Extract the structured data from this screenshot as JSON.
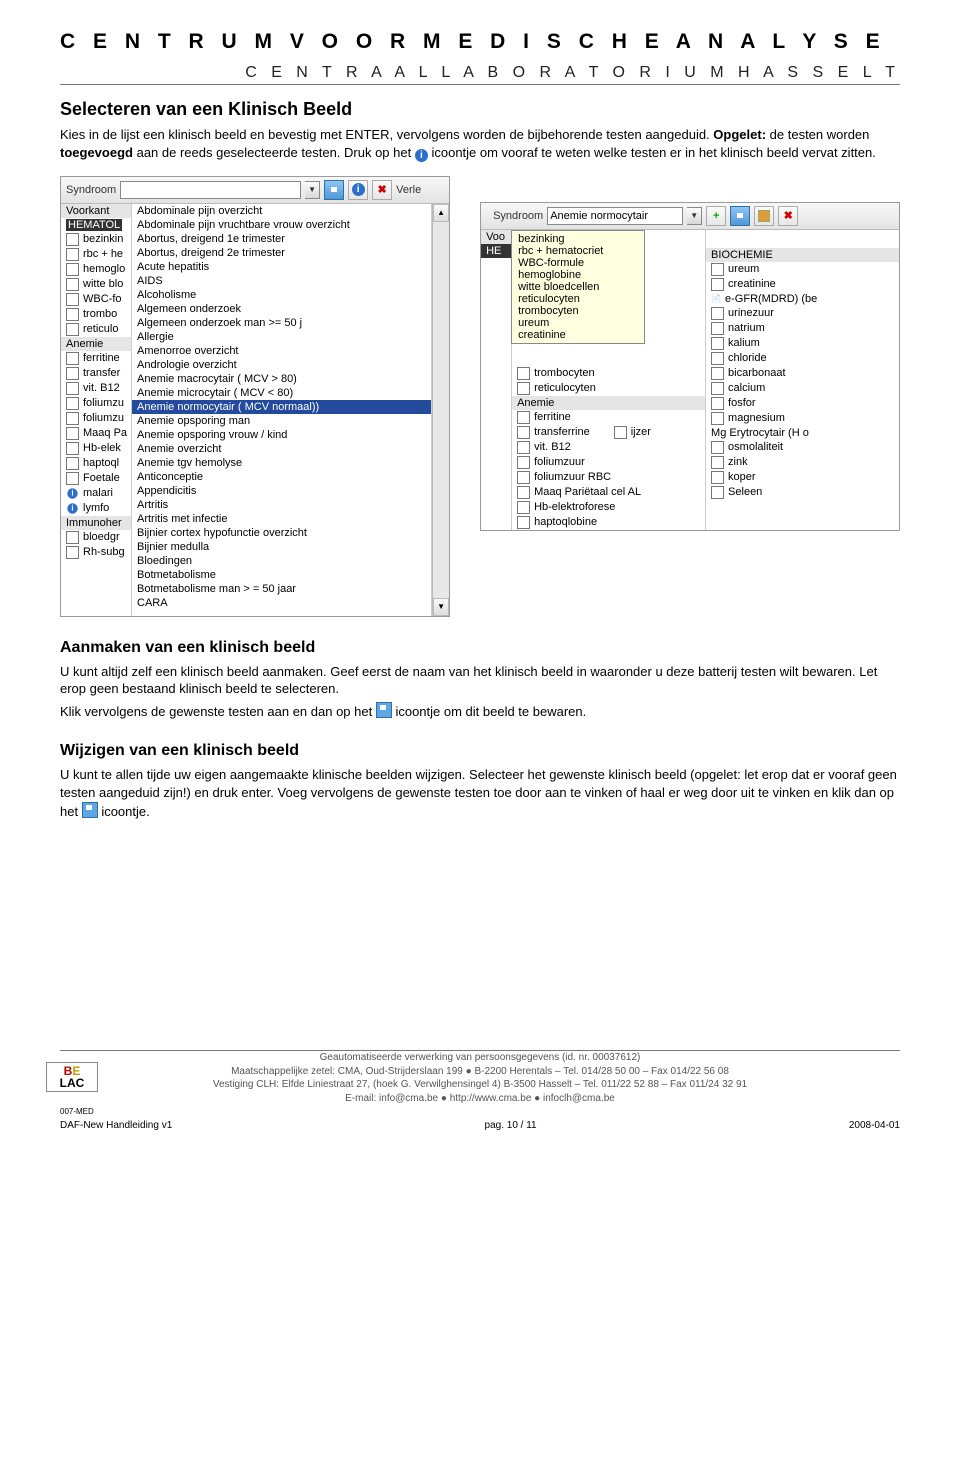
{
  "header": {
    "title": "C E N T R U M   V O O R   M E D I S C H E   A N A L Y S E",
    "subtitle": "C E N T R A A L   L A B O R A T O R I U M   H A S S E L T"
  },
  "section1": {
    "heading": "Selecteren van een Klinisch Beeld",
    "p1a": "Kies in de lijst een klinisch beeld en bevestig met ENTER, vervolgens worden de bijbehorende testen aangeduid. ",
    "p1b": "Opgelet:",
    "p1c": " de testen worden ",
    "p1d": "toegevoegd",
    "p1e": " aan de reeds geselecteerde testen. Druk op het ",
    "p1f": " icoontje om vooraf te weten welke testen er in het klinisch beeld vervat zitten."
  },
  "shot1": {
    "toolbar_label": "Syndroom",
    "after_toolbar": "Verle",
    "tab1": "Voorkant",
    "left_items_bold": "HEMATOL",
    "left_items": [
      "bezinkin",
      "rbc + he",
      "hemoglo",
      "witte blo",
      "WBC-fo",
      "trombo",
      "reticulo"
    ],
    "left_head2": "Anemie",
    "left_items2": [
      "ferritine",
      "transfer",
      "vit. B12",
      "foliumzu",
      "foliumzu",
      "Maaq Pa",
      "Hb-elek",
      "haptoql",
      "Foetale",
      "malari",
      "lymfo"
    ],
    "left_head3": "Immunoher",
    "left_items3": [
      "bloedgr",
      "Rh-subg"
    ],
    "dropdown": [
      "Abdominale pijn overzicht",
      "Abdominale pijn vruchtbare vrouw overzicht",
      "Abortus, dreigend 1e trimester",
      "Abortus, dreigend 2e trimester",
      "Acute hepatitis",
      "AIDS",
      "Alcoholisme",
      "Algemeen onderzoek",
      "Algemeen onderzoek man >= 50 j",
      "Allergie",
      "Amenorroe overzicht",
      "Andrologie overzicht",
      "Anemie macrocytair ( MCV > 80)",
      "Anemie microcytair ( MCV  < 80)",
      "Anemie normocytair ( MCV normaal))",
      "Anemie opsporing man",
      "Anemie opsporing vrouw / kind",
      "Anemie overzicht",
      "Anemie tgv hemolyse",
      "Anticonceptie",
      "Appendicitis",
      "Artritis",
      "Artritis met infectie",
      "Bijnier cortex hypofunctie overzicht",
      "Bijnier medulla",
      "Bloedingen",
      "Botmetabolisme",
      "Botmetabolisme man > = 50 jaar",
      "CARA"
    ],
    "dropdown_selected_index": 14
  },
  "shot2": {
    "toolbar_label": "Syndroom",
    "toolbar_value": "Anemie normocytair",
    "plus": "+",
    "voo_label": "Voo",
    "he_label": "HE",
    "left_panel": [
      "bezinking",
      "rbc + hematocriet",
      "WBC-formule",
      "hemoglobine",
      "witte bloedcellen",
      "reticulocyten",
      "trombocyten",
      "ureum",
      "creatinine"
    ],
    "col1": [
      "trombocyten",
      "reticulocyten"
    ],
    "col1_head": "Anemie",
    "col1_items": [
      "ferritine",
      "transferrine",
      "vit. B12",
      "foliumzuur",
      "foliumzuur RBC",
      "Maaq Pariëtaal cel AL",
      "Hb-elektroforese",
      "haptoqlobine"
    ],
    "col1_extra": "ijzer",
    "col2_head": "BIOCHEMIE",
    "col2_items": [
      "ureum",
      "creatinine",
      "e-GFR(MDRD) (be",
      "urinezuur",
      "natrium",
      "kalium",
      "chloride",
      "bicarbonaat",
      "calcium",
      "fosfor",
      "magnesium",
      "Mg Erytrocytair (H o",
      "osmolaliteit",
      "zink",
      "koper",
      "Seleen"
    ]
  },
  "section2": {
    "heading": "Aanmaken van een klinisch beeld",
    "p1": "U kunt altijd zelf een klinisch beeld aanmaken. Geef eerst de naam van het klinisch beeld in waaronder u deze batterij testen wilt bewaren. Let erop geen bestaand klinisch beeld te selecteren.",
    "p2a": "Klik vervolgens de gewenste testen aan en dan op het ",
    "p2b": " icoontje om dit beeld te bewaren."
  },
  "section3": {
    "heading": "Wijzigen van een klinisch beeld",
    "p1": "U kunt te allen tijde uw eigen aangemaakte klinische beelden wijzigen. Selecteer het gewenste klinisch beeld (opgelet: let erop dat er vooraf geen testen aangeduid zijn!) en druk enter. Voeg vervolgens de gewenste testen toe door aan te vinken of haal er weg door uit te vinken en klik dan op het ",
    "p1b": " icoontje."
  },
  "footer": {
    "line1": "Geautomatiseerde verwerking van persoonsgegevens (id. nr. 00037612)",
    "line2": "Maatschappelijke zetel: CMA, Oud-Strijderslaan 199 ● B-2200 Herentals – Tel. 014/28 50 00 – Fax 014/22 56 08",
    "line3": "Vestiging CLH: Elfde Liniestraat 27, (hoek G. Verwilghensingel 4) B-3500 Hasselt – Tel. 011/22 52 88 – Fax  011/24 32 91",
    "line4": "E-mail: info@cma.be ● http://www.cma.be ● infoclh@cma.be",
    "belac_code": "007-MED",
    "doc_id": "DAF-New Handleiding v1",
    "page": "pag. 10 / 11",
    "date": "2008-04-01"
  }
}
